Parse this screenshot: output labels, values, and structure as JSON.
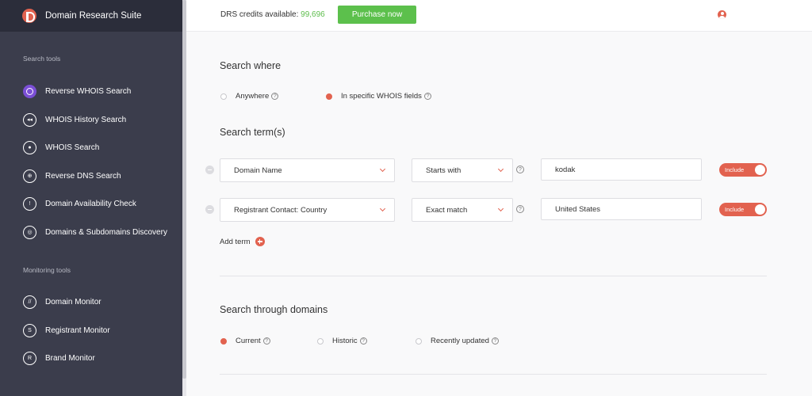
{
  "app": {
    "title": "Domain Research Suite"
  },
  "sidebar": {
    "search_tools_label": "Search tools",
    "search_items": [
      {
        "label": "Reverse WHOIS Search",
        "icon": "reverse-whois-icon",
        "active": true
      },
      {
        "label": "WHOIS History Search",
        "icon": "history-icon"
      },
      {
        "label": "WHOIS Search",
        "icon": "whois-icon"
      },
      {
        "label": "Reverse DNS Search",
        "icon": "globe-icon"
      },
      {
        "label": "Domain Availability Check",
        "icon": "availability-icon"
      },
      {
        "label": "Domains & Subdomains Discovery",
        "icon": "discovery-icon"
      }
    ],
    "monitoring_tools_label": "Monitoring tools",
    "monitoring_items": [
      {
        "label": "Domain Monitor",
        "icon": "domain-monitor-icon"
      },
      {
        "label": "Registrant Monitor",
        "icon": "registrant-monitor-icon"
      },
      {
        "label": "Brand Monitor",
        "icon": "brand-monitor-icon"
      }
    ]
  },
  "topbar": {
    "credits_label": "DRS credits available:",
    "credits_value": "99,696",
    "purchase_label": "Purchase now"
  },
  "search_where": {
    "heading": "Search where",
    "options": [
      {
        "label": "Anywhere",
        "checked": false
      },
      {
        "label": "In specific WHOIS fields",
        "checked": true
      }
    ]
  },
  "search_terms": {
    "heading": "Search term(s)",
    "rows": [
      {
        "field": "Domain Name",
        "match": "Starts with",
        "value": "kodak",
        "toggle": "Include"
      },
      {
        "field": "Registrant Contact: Country",
        "match": "Exact match",
        "value": "United States",
        "toggle": "Include"
      }
    ],
    "add_term_label": "Add term"
  },
  "search_through": {
    "heading": "Search through domains",
    "options": [
      {
        "label": "Current",
        "checked": true
      },
      {
        "label": "Historic",
        "checked": false
      },
      {
        "label": "Recently updated",
        "checked": false
      }
    ]
  },
  "colors": {
    "accent": "#e2624f",
    "sidebar_bg": "#3b3d4c",
    "brand_bg": "#2b2d3a",
    "success": "#5cc04c",
    "active_nav": "#7b4fd6"
  }
}
